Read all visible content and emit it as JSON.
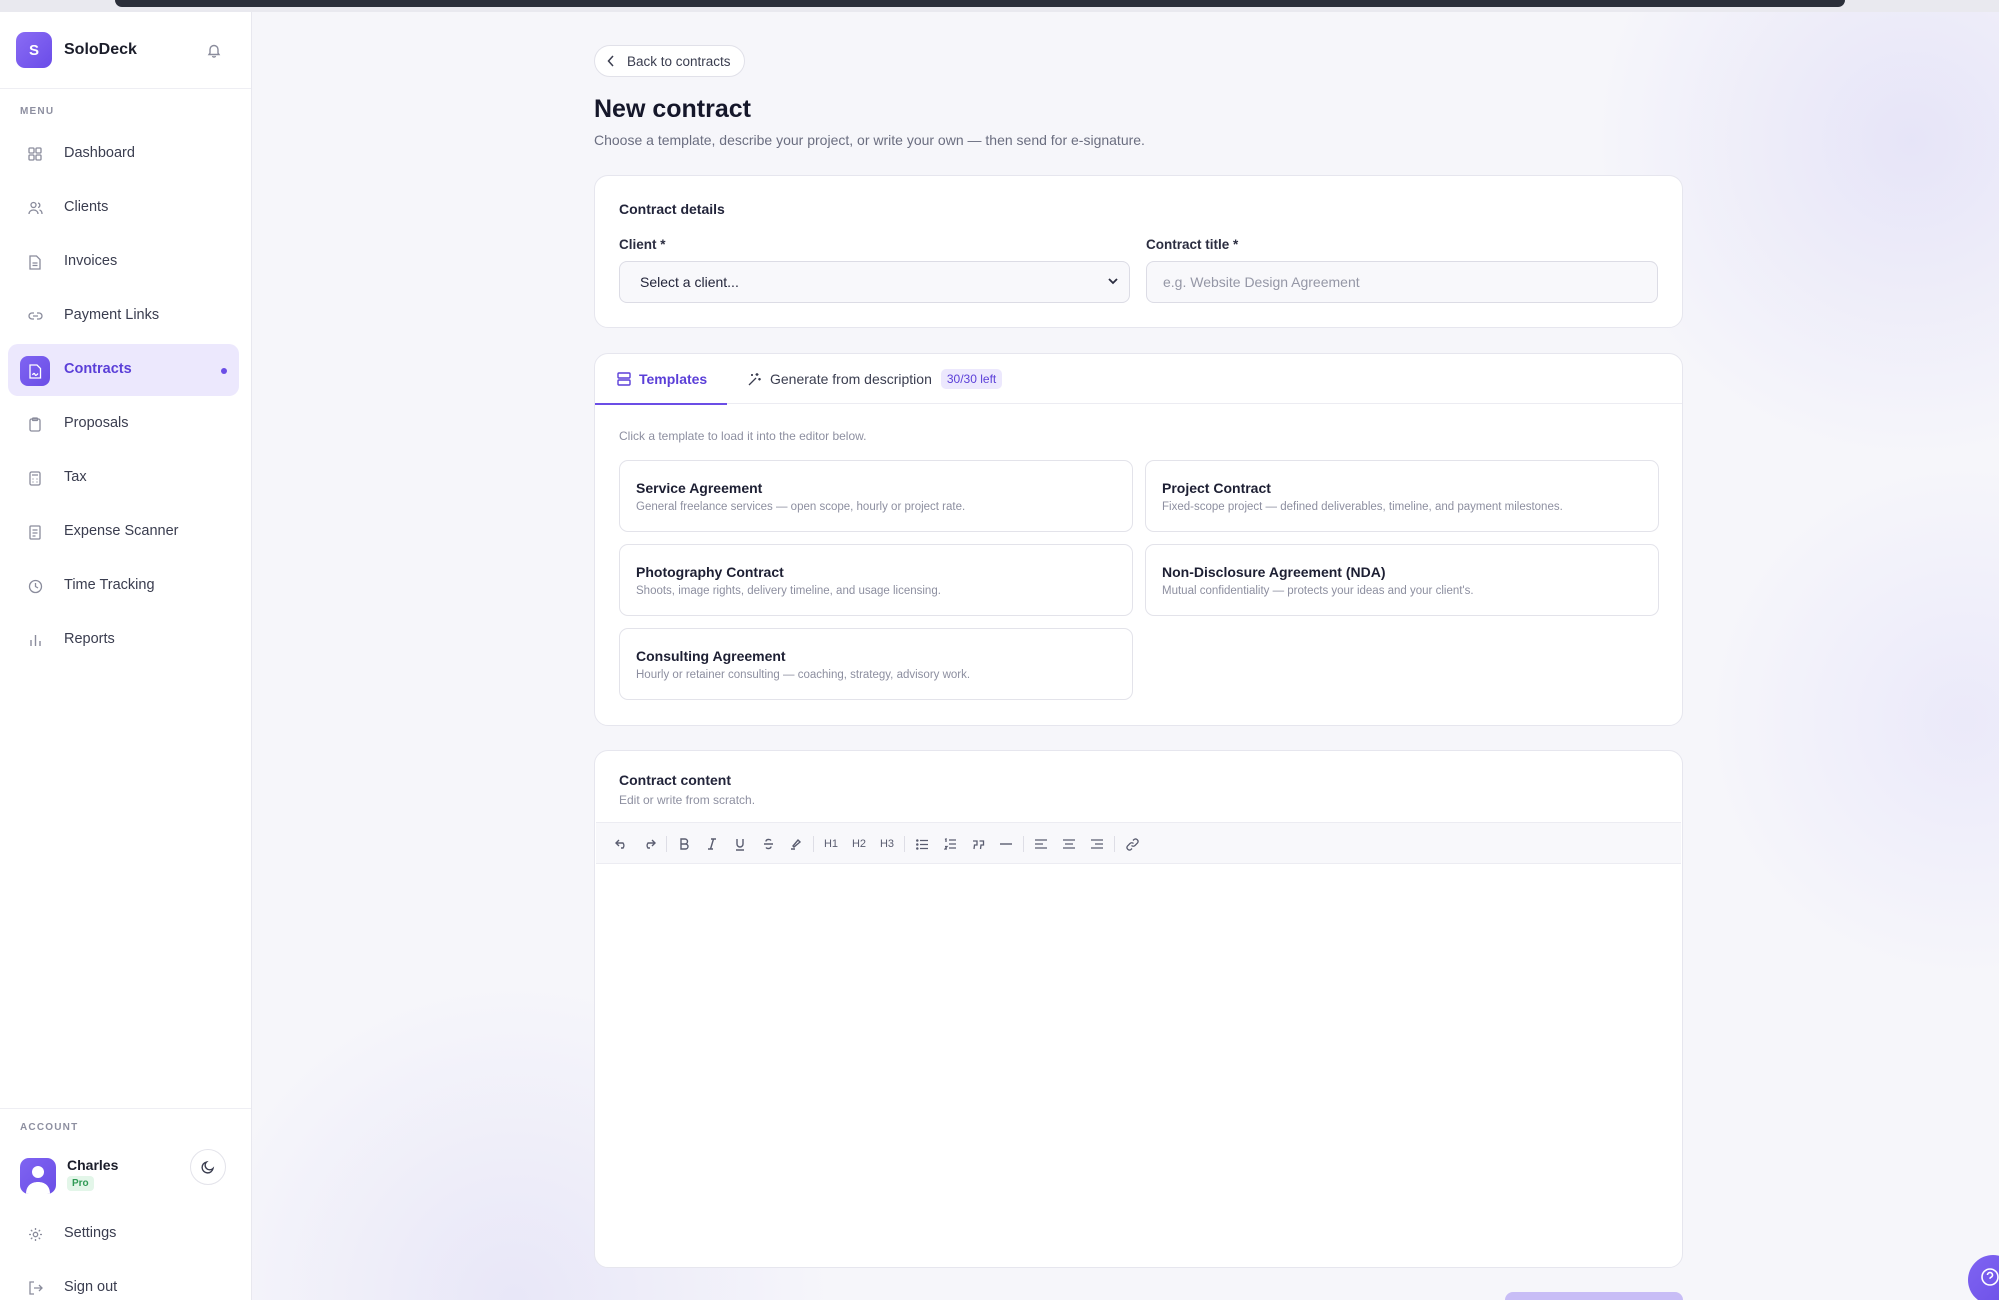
{
  "app": {
    "name": "SoloDeck",
    "logo_letter": "S"
  },
  "colors": {
    "accent": "#6b4ee6",
    "accent_light": "#ece8fd",
    "pro_badge": "#2f9a55"
  },
  "sidebar": {
    "menu_label": "MENU",
    "items": [
      {
        "label": "Dashboard",
        "icon": "grid-icon"
      },
      {
        "label": "Clients",
        "icon": "users-icon"
      },
      {
        "label": "Invoices",
        "icon": "document-icon"
      },
      {
        "label": "Payment Links",
        "icon": "link-icon"
      },
      {
        "label": "Contracts",
        "icon": "signature-icon",
        "active": true
      },
      {
        "label": "Proposals",
        "icon": "clipboard-icon"
      },
      {
        "label": "Tax",
        "icon": "calculator-icon"
      },
      {
        "label": "Expense Scanner",
        "icon": "receipt-icon"
      },
      {
        "label": "Time Tracking",
        "icon": "clock-icon"
      },
      {
        "label": "Reports",
        "icon": "bar-chart-icon"
      }
    ],
    "account_label": "ACCOUNT",
    "user": {
      "name": "Charles",
      "plan": "Pro"
    },
    "settings_label": "Settings",
    "signout_label": "Sign out"
  },
  "page": {
    "back_label": "Back to contracts",
    "title": "New contract",
    "subtitle": "Choose a template, describe your project, or write your own — then send for e-signature."
  },
  "details": {
    "title": "Contract details",
    "client_label": "Client *",
    "client_value": "Select a client...",
    "title_label": "Contract title *",
    "title_placeholder": "e.g. Website Design Agreement"
  },
  "templates_section": {
    "tab_templates": "Templates",
    "tab_generate": "Generate from description",
    "generate_quota": "30/30 left",
    "hint": "Click a template to load it into the editor below.",
    "items": [
      {
        "title": "Service Agreement",
        "desc": "General freelance services — open scope, hourly or project rate."
      },
      {
        "title": "Project Contract",
        "desc": "Fixed-scope project — defined deliverables, timeline, and payment milestones."
      },
      {
        "title": "Photography Contract",
        "desc": "Shoots, image rights, delivery timeline, and usage licensing."
      },
      {
        "title": "Non-Disclosure Agreement (NDA)",
        "desc": "Mutual confidentiality — protects your ideas and your client's."
      },
      {
        "title": "Consulting Agreement",
        "desc": "Hourly or retainer consulting — coaching, strategy, advisory work."
      }
    ]
  },
  "content": {
    "title": "Contract content",
    "subtitle": "Edit or write from scratch.",
    "toolbar": {
      "h1": "H1",
      "h2": "H2",
      "h3": "H3"
    }
  }
}
